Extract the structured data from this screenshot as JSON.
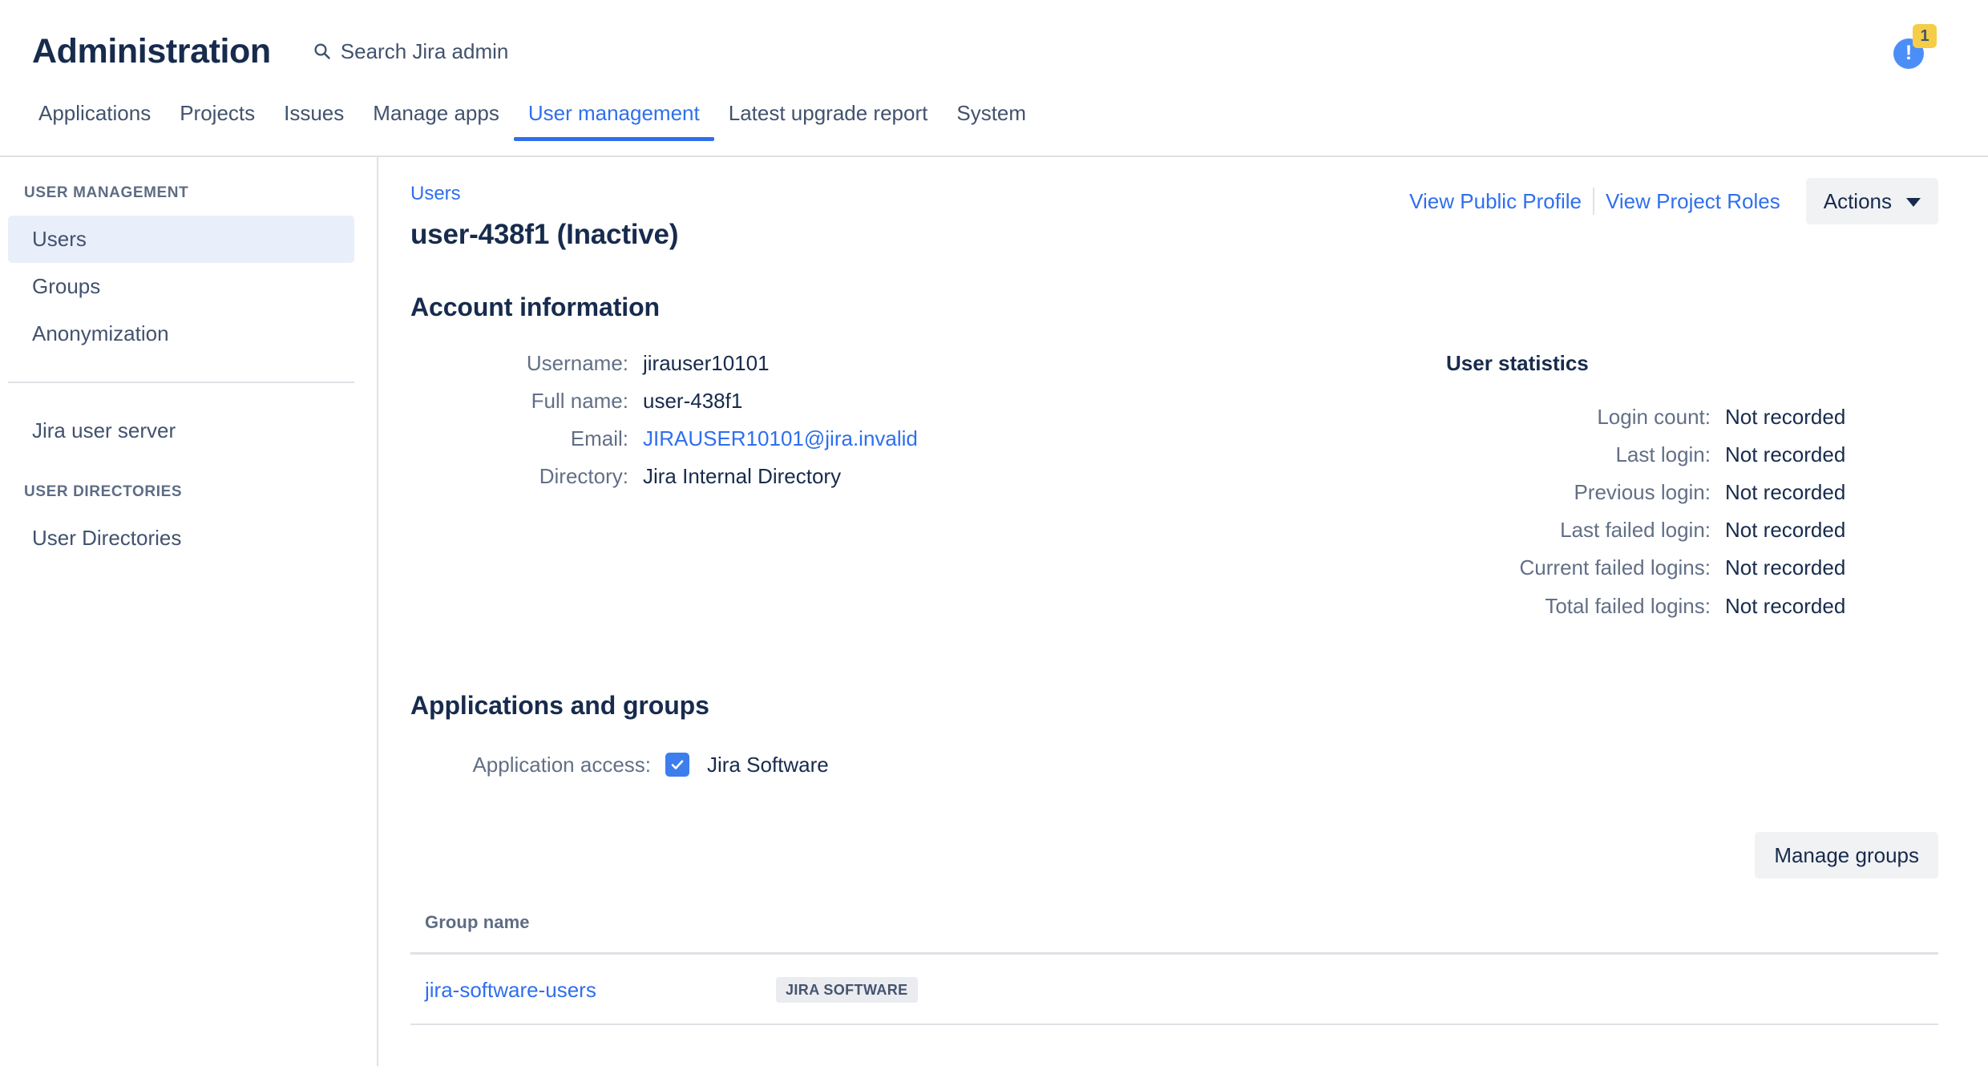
{
  "header": {
    "title": "Administration",
    "search": {
      "icon": "search-icon",
      "label": "Search Jira admin"
    },
    "notification": {
      "icon": "info-alert-icon",
      "badge_count": "1",
      "badge_color": "#F5CD47",
      "icon_color": "#4C8EF7"
    }
  },
  "nav_tabs": [
    {
      "label": "Applications",
      "active": false
    },
    {
      "label": "Projects",
      "active": false
    },
    {
      "label": "Issues",
      "active": false
    },
    {
      "label": "Manage apps",
      "active": false
    },
    {
      "label": "User management",
      "active": true
    },
    {
      "label": "Latest upgrade report",
      "active": false
    },
    {
      "label": "System",
      "active": false
    }
  ],
  "sidebar": {
    "section1_heading": "USER MANAGEMENT",
    "section1_items": [
      {
        "label": "Users",
        "active": true
      },
      {
        "label": "Groups",
        "active": false
      },
      {
        "label": "Anonymization",
        "active": false
      }
    ],
    "section2_items": [
      {
        "label": "Jira user server",
        "active": false
      }
    ],
    "section3_heading": "USER DIRECTORIES",
    "section3_items": [
      {
        "label": "User Directories",
        "active": false
      }
    ]
  },
  "main": {
    "breadcrumb": "Users",
    "page_title": "user-438f1 (Inactive)",
    "header_links": [
      {
        "label": "View Public Profile"
      },
      {
        "label": "View Project Roles"
      }
    ],
    "actions_button": "Actions",
    "account_section": {
      "title": "Account information",
      "fields": [
        {
          "label": "Username:",
          "value": "jirauser10101",
          "is_link": false
        },
        {
          "label": "Full name:",
          "value": "user-438f1",
          "is_link": false
        },
        {
          "label": "Email:",
          "value": "JIRAUSER10101@jira.invalid",
          "is_link": true
        },
        {
          "label": "Directory:",
          "value": "Jira Internal Directory",
          "is_link": false
        }
      ]
    },
    "user_statistics": {
      "title": "User statistics",
      "fields": [
        {
          "label": "Login count:",
          "value": "Not recorded"
        },
        {
          "label": "Last login:",
          "value": "Not recorded"
        },
        {
          "label": "Previous login:",
          "value": "Not recorded"
        },
        {
          "label": "Last failed login:",
          "value": "Not recorded"
        },
        {
          "label": "Current failed logins:",
          "value": "Not recorded"
        },
        {
          "label": "Total failed logins:",
          "value": "Not recorded"
        }
      ]
    },
    "apps_groups_section": {
      "title": "Applications and groups",
      "access_label": "Application access:",
      "access_app": "Jira Software",
      "access_checked": true,
      "manage_groups_button": "Manage groups",
      "table": {
        "columns": [
          "Group name",
          ""
        ],
        "rows": [
          {
            "name": "jira-software-users",
            "badge": "JIRA SOFTWARE"
          }
        ]
      }
    }
  }
}
